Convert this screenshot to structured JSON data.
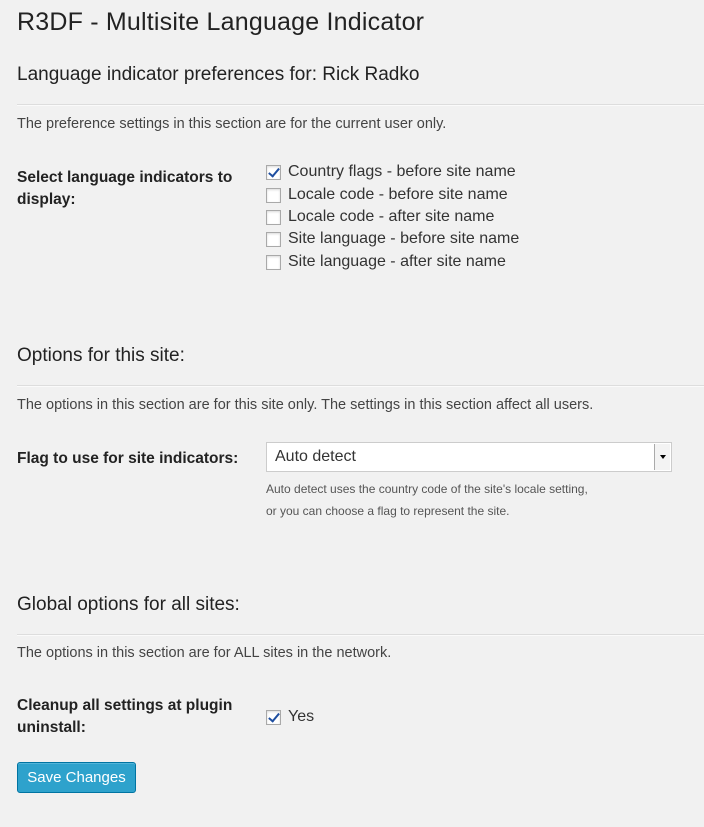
{
  "page_title": "R3DF - Multisite Language Indicator",
  "user_section": {
    "heading": "Language indicator preferences for: Rick Radko",
    "description": "The preference settings in this section are for the current user only.",
    "field_label": "Select language indicators to display:",
    "options": [
      {
        "label": "Country flags - before site name",
        "checked": true
      },
      {
        "label": "Locale code - before site name",
        "checked": false
      },
      {
        "label": "Locale code - after site name",
        "checked": false
      },
      {
        "label": "Site language - before site name",
        "checked": false
      },
      {
        "label": "Site language - after site name",
        "checked": false
      }
    ]
  },
  "site_section": {
    "heading": "Options for this site:",
    "description": "The options in this section are for this site only. The settings in this section affect all users.",
    "field_label": "Flag to use for site indicators:",
    "select_value": "Auto detect",
    "help_line1": "Auto detect uses the country code of the site's locale setting,",
    "help_line2": "or you can choose a flag to represent the site."
  },
  "global_section": {
    "heading": "Global options for all sites:",
    "description": "The options in this section are for ALL sites in the network.",
    "field_label": "Cleanup all settings at plugin uninstall:",
    "checkbox_label": "Yes",
    "checked": true
  },
  "save_button": "Save Changes",
  "colors": {
    "background": "#f1f1f1",
    "button": "#2ea2cc",
    "button_border": "#0074a2"
  }
}
